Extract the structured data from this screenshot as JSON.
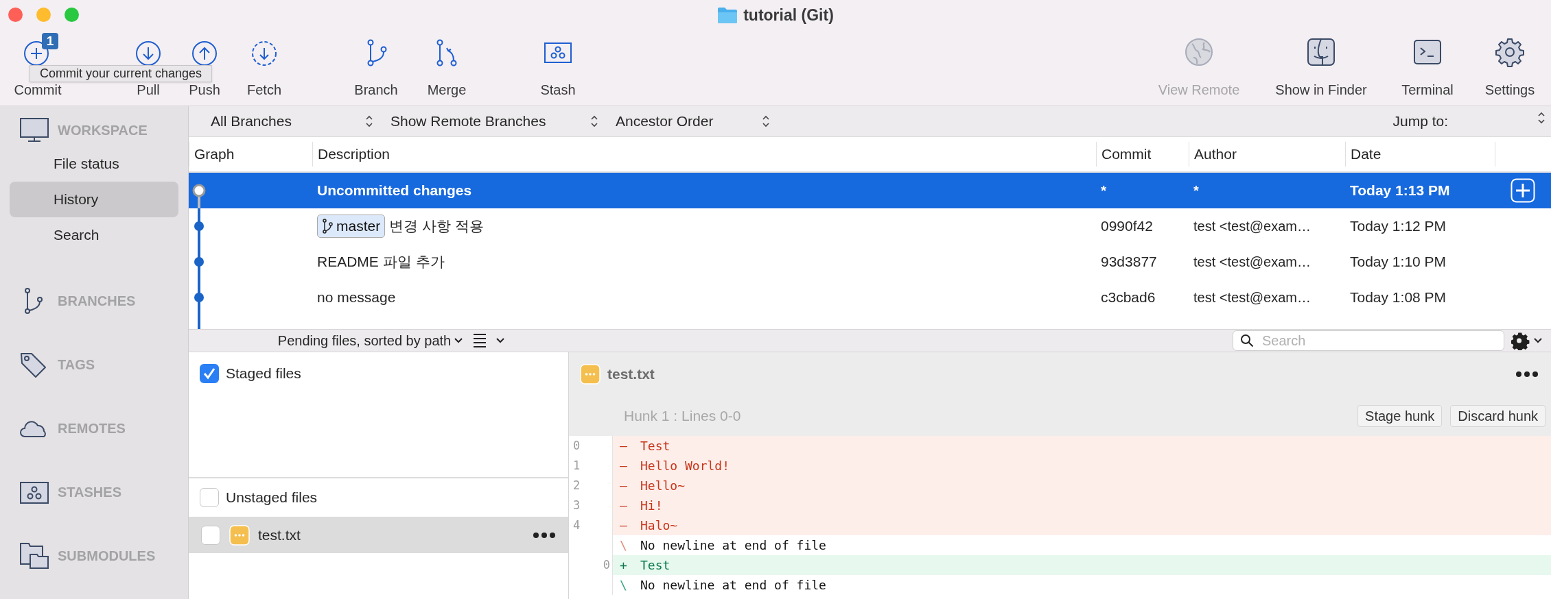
{
  "window": {
    "title": "tutorial (Git)"
  },
  "toolbar": {
    "items": [
      {
        "kind": "commit",
        "label": "Commit",
        "badge": "1",
        "disabled": false
      },
      {
        "kind": "pull",
        "label": "Pull",
        "disabled": false
      },
      {
        "kind": "push",
        "label": "Push",
        "disabled": false
      },
      {
        "kind": "fetch",
        "label": "Fetch",
        "disabled": false
      },
      {
        "kind": "branch",
        "label": "Branch",
        "disabled": false
      },
      {
        "kind": "merge",
        "label": "Merge",
        "disabled": false
      },
      {
        "kind": "stash",
        "label": "Stash",
        "disabled": false
      },
      {
        "kind": "view_remote",
        "label": "View Remote",
        "disabled": true
      },
      {
        "kind": "finder",
        "label": "Show in Finder",
        "disabled": false
      },
      {
        "kind": "terminal",
        "label": "Terminal",
        "disabled": false
      },
      {
        "kind": "settings",
        "label": "Settings",
        "disabled": false
      }
    ]
  },
  "tooltip": "Commit your current changes",
  "sidebar": {
    "sections": [
      {
        "kind": "workspace",
        "title": "WORKSPACE",
        "items": [
          {
            "label": "File status",
            "selected": false
          },
          {
            "label": "History",
            "selected": true
          },
          {
            "label": "Search",
            "selected": false
          }
        ]
      },
      {
        "kind": "branches",
        "title": "BRANCHES"
      },
      {
        "kind": "tags",
        "title": "TAGS"
      },
      {
        "kind": "remotes",
        "title": "REMOTES"
      },
      {
        "kind": "stashes",
        "title": "STASHES"
      },
      {
        "kind": "submodules",
        "title": "SUBMODULES"
      }
    ]
  },
  "filter_bar": {
    "selects": [
      "All Branches",
      "Show Remote Branches",
      "Ancestor Order"
    ],
    "jump_to": "Jump to:"
  },
  "history": {
    "columns": [
      "Graph",
      "Description",
      "Commit",
      "Author",
      "Date"
    ],
    "rows": [
      {
        "kind": "uncommitted",
        "selected": true,
        "description": "Uncommitted changes",
        "commit": "*",
        "author": "*",
        "date": "Today 1:13 PM"
      },
      {
        "kind": "commit",
        "selected": false,
        "branch": "master",
        "description": "변경 사항 적용",
        "commit": "0990f42",
        "author": "test <test@exam…",
        "date": "Today 1:12 PM"
      },
      {
        "kind": "commit",
        "selected": false,
        "description": "README 파일 추가",
        "commit": "93d3877",
        "author": "test <test@exam…",
        "date": "Today 1:10 PM"
      },
      {
        "kind": "commit",
        "selected": false,
        "description": "no message",
        "commit": "c3cbad6",
        "author": "test <test@exam…",
        "date": "Today 1:08 PM"
      }
    ]
  },
  "pending_bar": {
    "sort_label": "Pending files, sorted by path",
    "search_placeholder": "Search"
  },
  "staged": {
    "title": "Staged files",
    "checked": true
  },
  "unstaged": {
    "title": "Unstaged files",
    "checked": false,
    "files": [
      {
        "name": "test.txt",
        "checked": false,
        "selected": true
      }
    ]
  },
  "diff": {
    "file": "test.txt",
    "hunk": {
      "title": "Hunk 1 : Lines 0-0",
      "buttons": [
        "Stage hunk",
        "Discard hunk"
      ]
    },
    "lines": [
      {
        "kind": "removed",
        "old": "0",
        "marker": "–",
        "text": "Test"
      },
      {
        "kind": "removed",
        "old": "1",
        "marker": "–",
        "text": "Hello World!"
      },
      {
        "kind": "removed",
        "old": "2",
        "marker": "–",
        "text": "Hello~"
      },
      {
        "kind": "removed",
        "old": "3",
        "marker": "–",
        "text": "Hi!"
      },
      {
        "kind": "removed",
        "old": "4",
        "marker": "–",
        "text": "Halo~"
      },
      {
        "kind": "nonewline_old",
        "marker": "\\",
        "text": "No newline at end of file"
      },
      {
        "kind": "added",
        "new": "0",
        "marker": "+",
        "text": "Test"
      },
      {
        "kind": "nonewline_new",
        "marker": "\\",
        "text": "No newline at end of file"
      }
    ]
  }
}
